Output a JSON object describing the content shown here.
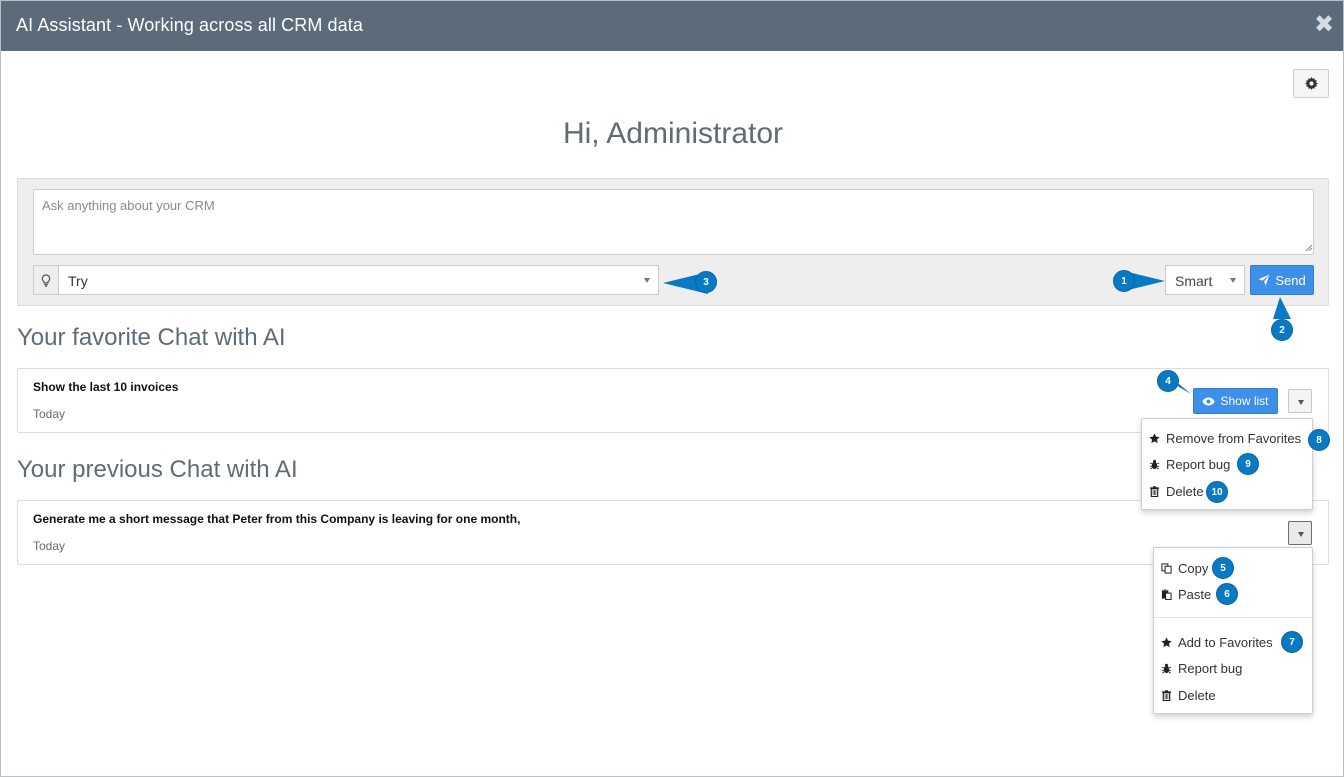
{
  "window": {
    "title": "AI Assistant - Working across all CRM data",
    "close_icon": "close-icon"
  },
  "header": {
    "greeting": "Hi, Administrator",
    "settings_icon": "gear-icon"
  },
  "ask": {
    "placeholder": "Ask anything about your CRM",
    "try_label": "Try",
    "try_icon": "lightbulb-icon",
    "mode_value": "Smart",
    "send_label": "Send",
    "send_icon": "paper-plane-icon"
  },
  "favorites": {
    "title": "Your favorite Chat with AI",
    "items": [
      {
        "message": "Show the last 10 invoices",
        "date": "Today",
        "show_list_label": "Show list"
      }
    ],
    "menu": [
      {
        "label": "Remove from Favorites",
        "icon": "star-icon"
      },
      {
        "label": "Report bug",
        "icon": "bug-icon"
      },
      {
        "label": "Delete",
        "icon": "trash-icon"
      }
    ]
  },
  "previous": {
    "title": "Your previous Chat with AI",
    "items": [
      {
        "message": "Generate me a short message that Peter from this Company is leaving for one month,",
        "date": "Today"
      }
    ],
    "menu": [
      {
        "label": "Copy",
        "icon": "copy-icon"
      },
      {
        "label": "Paste",
        "icon": "paste-icon"
      },
      {
        "label": "Add to Favorites",
        "icon": "star-icon"
      },
      {
        "label": "Report bug",
        "icon": "bug-icon"
      },
      {
        "label": "Delete",
        "icon": "trash-icon"
      }
    ]
  },
  "callouts": [
    "1",
    "2",
    "3",
    "4",
    "5",
    "6",
    "7",
    "8",
    "9",
    "10"
  ],
  "colors": {
    "titlebar": "#5b6b7a",
    "primary": "#3d8fe8",
    "callout": "#0a79c3",
    "heading": "#5f6c78"
  }
}
